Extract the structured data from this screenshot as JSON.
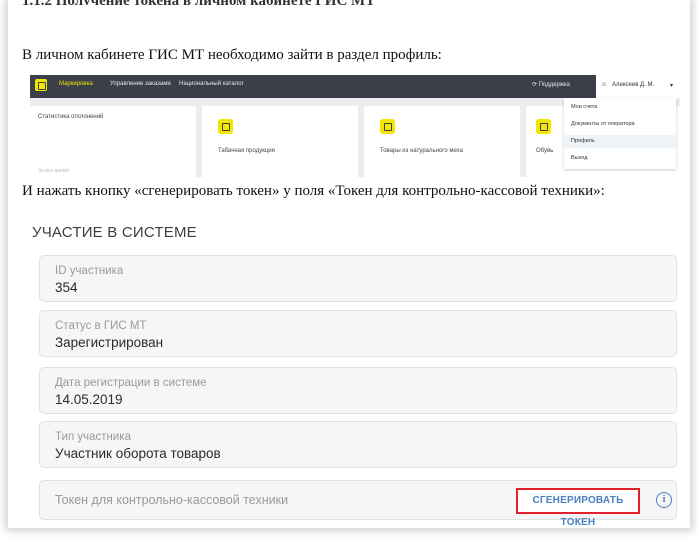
{
  "document": {
    "intro_text": "В личном кабинете ГИС МТ необходимо зайти в раздел профиль:",
    "instruction_text": "И нажать кнопку «сгенерировать токен» у поля «Токен для контрольно-кассовой техники»:"
  },
  "app_screenshot": {
    "nav": {
      "items": [
        "Маркировка",
        "Управление заказами",
        "Национальный каталог"
      ],
      "support": "Поддержка",
      "user": "Алексеев Д. М."
    },
    "cards": [
      {
        "title": "Статистика отклонений",
        "faded": "За все время"
      },
      {
        "title": "Табачная продукция"
      },
      {
        "title": "Товары из натурального меха"
      },
      {
        "title": "Обувь"
      }
    ],
    "dropdown_menu": [
      "Мои счета",
      "Документы от оператора",
      "Профиль",
      "Выход"
    ],
    "active_menu_item": "Профиль"
  },
  "form_screenshot": {
    "section_title": "УЧАСТИЕ В СИСТЕМЕ",
    "fields": [
      {
        "label": "ID участника",
        "value": "354"
      },
      {
        "label": "Статус в ГИС МТ",
        "value": "Зарегистрирован"
      },
      {
        "label": "Дата регистрации в системе",
        "value": "14.05.2019"
      },
      {
        "label": "Тип участника",
        "value": "Участник оборота товаров"
      }
    ],
    "token_field_label": "Токен для контрольно-кассовой техники",
    "generate_button_label": "СГЕНЕРИРОВАТЬ ТОКЕН",
    "info_icon_glyph": "i",
    "colors": {
      "accent": "#4a7fc1",
      "highlight_border": "#e0212b",
      "brand_yellow": "#f2e500",
      "nav_bg": "#3a3f4a"
    }
  }
}
